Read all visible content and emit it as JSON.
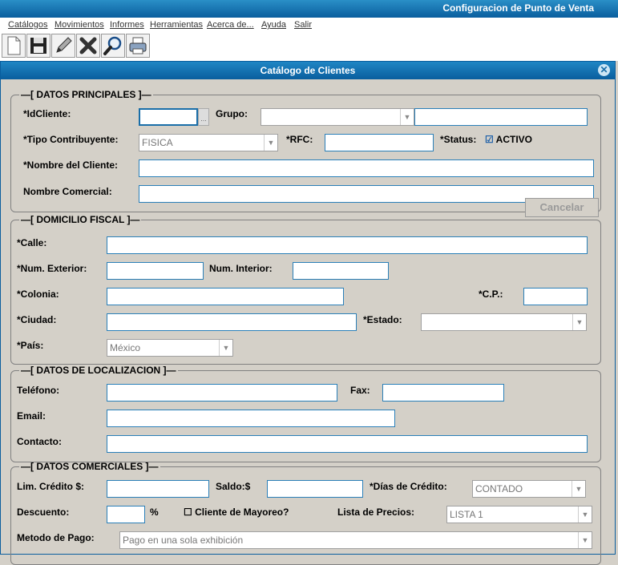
{
  "app_title": "Configuracion de Punto de Venta",
  "menu": [
    "Catálogos",
    "Movimientos",
    "Informes",
    "Herramientas",
    "Acerca de...",
    "Ayuda",
    "Salir"
  ],
  "toolbar": [
    "new-icon",
    "save-icon",
    "edit-icon",
    "delete-icon",
    "search-icon",
    "print-icon"
  ],
  "dialog_title": "Catálogo de Clientes",
  "principales": {
    "legend": "—[ DATOS PRINCIPALES ]—",
    "idcliente_label": "*IdCliente:",
    "ellipsis": "...",
    "grupo_label": "Grupo:",
    "tipo_label": "*Tipo Contribuyente:",
    "tipo_value": "FISICA",
    "rfc_label": "*RFC:",
    "status_label": "*Status:",
    "status_check": "☑",
    "status_value": "ACTIVO",
    "nombre_label": "*Nombre del Cliente:",
    "comercial_label": "Nombre Comercial:",
    "cancel_label": "Cancelar"
  },
  "fiscal": {
    "legend": "—[ DOMICILIO FISCAL ]—",
    "calle": "*Calle:",
    "num_ext": "*Num. Exterior:",
    "num_int": "Num. Interior:",
    "colonia": "*Colonia:",
    "cp": "*C.P.:",
    "ciudad": "*Ciudad:",
    "estado": "*Estado:",
    "pais": "*País:",
    "pais_value": "México"
  },
  "localizacion": {
    "legend": "—[ DATOS DE LOCALIZACION ]—",
    "telefono": "Teléfono:",
    "fax": "Fax:",
    "email": "Email:",
    "contacto": "Contacto:"
  },
  "comerciales": {
    "legend": "—[ DATOS COMERCIALES ]—",
    "credito": "Lim. Crédito $:",
    "saldo": "Saldo:$",
    "dias": "*Días de Crédito:",
    "dias_value": "CONTADO",
    "descuento": "Descuento:",
    "pct": "%",
    "mayoreo_check": "☐",
    "mayoreo": "Cliente de Mayoreo?",
    "lista": "Lista de Precios:",
    "lista_value": "LISTA 1",
    "metodo": "Metodo de Pago:",
    "metodo_value": "Pago en una sola exhibición"
  }
}
